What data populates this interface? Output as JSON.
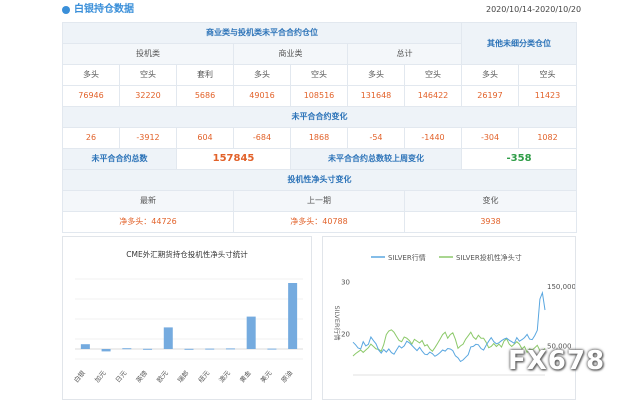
{
  "header": {
    "title": "白银持仓数据",
    "date_range": "2020/10/14-2020/10/20"
  },
  "stats": {
    "top_title": "商业类与投机类未平合合约仓位",
    "other_title": "其他未细分类仓位",
    "groups": [
      "投机类",
      "商业类",
      "总计"
    ],
    "col_labels": [
      "多头",
      "空头",
      "套利",
      "多头",
      "空头",
      "多头",
      "空头",
      "多头",
      "空头"
    ],
    "values": [
      "76946",
      "32220",
      "5686",
      "49016",
      "108516",
      "131648",
      "146422",
      "26197",
      "11423"
    ],
    "change_title": "未平合合约变化",
    "changes": [
      "26",
      "-3912",
      "604",
      "-684",
      "1868",
      "-54",
      "-1440",
      "-304",
      "1082"
    ],
    "total_label": "未平合合约总数",
    "total_value": "157845",
    "week_change_label": "未平合合约总数较上周变化",
    "week_change_value": "-358",
    "spec_title": "投机性净头寸变化",
    "spec_cols": [
      "最新",
      "上一期",
      "变化"
    ],
    "spec_latest": "净多头：44726",
    "spec_prev": "净多头：40788",
    "spec_change": "3938"
  },
  "colors": {
    "accent": "#3a8fd9",
    "bar": "#75abdf",
    "silver_line": "#5aa7e0",
    "spec_line": "#8cc96a",
    "value_orange": "#e2622a",
    "value_green": "#2f9d47"
  },
  "chart_data": [
    {
      "type": "bar",
      "title": "CME外汇期货持仓投机性净头寸统计",
      "categories": [
        "白银",
        "加元",
        "日元",
        "英镑",
        "欧元",
        "瑞郎",
        "纽元",
        "澳元",
        "黄金",
        "美元",
        "原油"
      ],
      "values": [
        2.4,
        -1.2,
        0.4,
        0.1,
        10.8,
        0.1,
        0.2,
        0.3,
        16.2,
        0.2,
        33.0
      ],
      "ylim": [
        -5,
        40
      ]
    },
    {
      "type": "line",
      "legend": [
        "SILVER行情",
        "SILVER投机性净头寸"
      ],
      "legend_position": "top",
      "left_axis": {
        "label": "SILVER行情",
        "ticks": [
          "30",
          "20"
        ],
        "range": [
          12,
          32
        ]
      },
      "right_axis": {
        "ticks": [
          "150,000",
          "50,000"
        ],
        "range": [
          0,
          175000
        ]
      },
      "series": [
        {
          "name": "SILVER行情",
          "axis": "left",
          "values": [
            18.3,
            17.8,
            17.2,
            17.0,
            18.4,
            17.6,
            17.9,
            19.3,
            18.6,
            18.0,
            16.8,
            16.2,
            16.9,
            16.4,
            17.0,
            16.3,
            16.0,
            16.8,
            17.6,
            17.2,
            17.6,
            18.5,
            18.2,
            17.7,
            17.2,
            16.7,
            17.3,
            16.6,
            16.0,
            15.9,
            16.4,
            16.1,
            15.6,
            15.9,
            16.3,
            16.8,
            16.6,
            17.1,
            17.0,
            16.7,
            15.7,
            15.3,
            14.6,
            14.9,
            15.4,
            15.9,
            17.4,
            17.5,
            17.9,
            17.8,
            17.1,
            16.8,
            17.7,
            18.5,
            19.2,
            18.4,
            18.0,
            18.2,
            18.6,
            18.9,
            19.1,
            18.7,
            18.4,
            18.1,
            19.2,
            18.5,
            18.8,
            19.2,
            19.8,
            18.9,
            18.8,
            19.6,
            20.6,
            26.6,
            27.8,
            24.5
          ]
        },
        {
          "name": "SILVER投机性净头寸",
          "axis": "right",
          "values": [
            32000,
            36000,
            39000,
            42000,
            38000,
            42000,
            46000,
            52000,
            48000,
            44000,
            43000,
            40000,
            51000,
            68000,
            74000,
            76000,
            72000,
            65000,
            58000,
            56000,
            64000,
            62000,
            58000,
            52000,
            60000,
            57000,
            54000,
            58000,
            49000,
            51000,
            44000,
            40000,
            46000,
            53000,
            60000,
            68000,
            72000,
            62000,
            68000,
            71000,
            60000,
            45000,
            49000,
            52000,
            60000,
            66000,
            72000,
            64000,
            60000,
            67000,
            62000,
            62000,
            55000,
            46000,
            48000,
            53000,
            48000,
            52000,
            47000,
            57000,
            61000,
            52000,
            48000,
            52000,
            56000,
            52000,
            44000,
            48000,
            38000,
            44000,
            42000,
            46000,
            50000,
            41000,
            40000,
            45000
          ]
        }
      ]
    }
  ]
}
